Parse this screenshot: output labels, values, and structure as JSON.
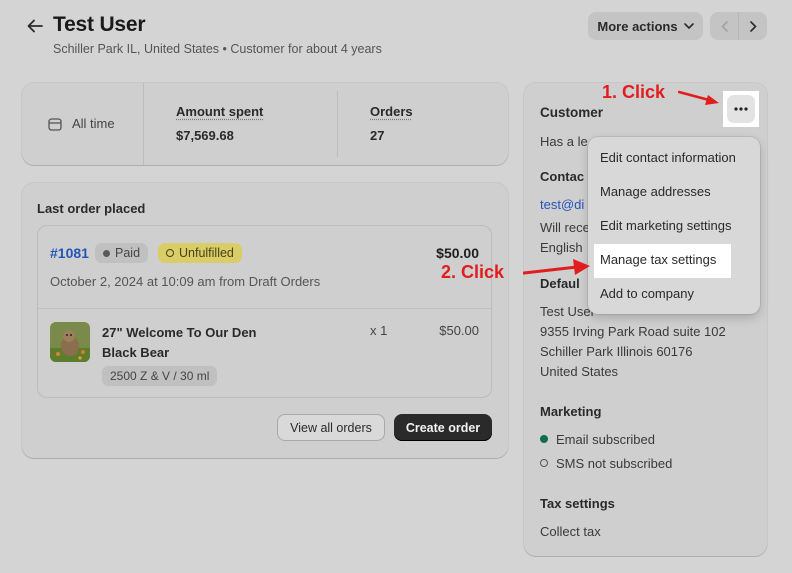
{
  "header": {
    "title": "Test User",
    "subtitle": "Schiller Park IL, United States • Customer for about 4 years",
    "more_actions_label": "More actions"
  },
  "stats": {
    "period_label": "All time",
    "amount_spent_label": "Amount spent",
    "amount_spent_value": "$7,569.68",
    "orders_label": "Orders",
    "orders_value": "27"
  },
  "last_order": {
    "heading": "Last order placed",
    "order_number": "#1081",
    "payment_badge": "Paid",
    "fulfillment_badge": "Unfulfilled",
    "total": "$50.00",
    "date_line": "October 2, 2024 at 10:09 am from Draft Orders",
    "item": {
      "name_line1": "27\" Welcome To Our Den",
      "name_line2": "Black Bear",
      "variant": "2500 Z & V / 30 ml",
      "quantity": "x 1",
      "price": "$50.00"
    },
    "view_all_label": "View all orders",
    "create_label": "Create order"
  },
  "customer": {
    "heading": "Customer",
    "note_partial": "Has a le",
    "contact_heading_partial": "Contac",
    "email_partial": "test@di",
    "marketing_partial": "Will rece",
    "language_partial": "English",
    "address_heading_partial": "Defaul",
    "address_lines": [
      "Test User",
      "9355 Irving Park Road suite 102",
      "Schiller Park Illinois 60176",
      "United States"
    ],
    "marketing_heading": "Marketing",
    "email_status": "Email subscribed",
    "sms_status": "SMS not subscribed",
    "tax_heading": "Tax settings",
    "tax_value": "Collect tax"
  },
  "dropdown": {
    "items": [
      "Edit contact information",
      "Manage addresses",
      "Edit marketing settings",
      "Manage tax settings",
      "Add to company"
    ]
  },
  "annotations": {
    "step1": "1. Click",
    "step2": "2. Click"
  },
  "colors": {
    "annotation_red": "#e11d1d",
    "link_blue": "#2456b8",
    "subscribed_green": "#0f6e4f",
    "unfulfilled_yellow": "#d9cd68"
  }
}
